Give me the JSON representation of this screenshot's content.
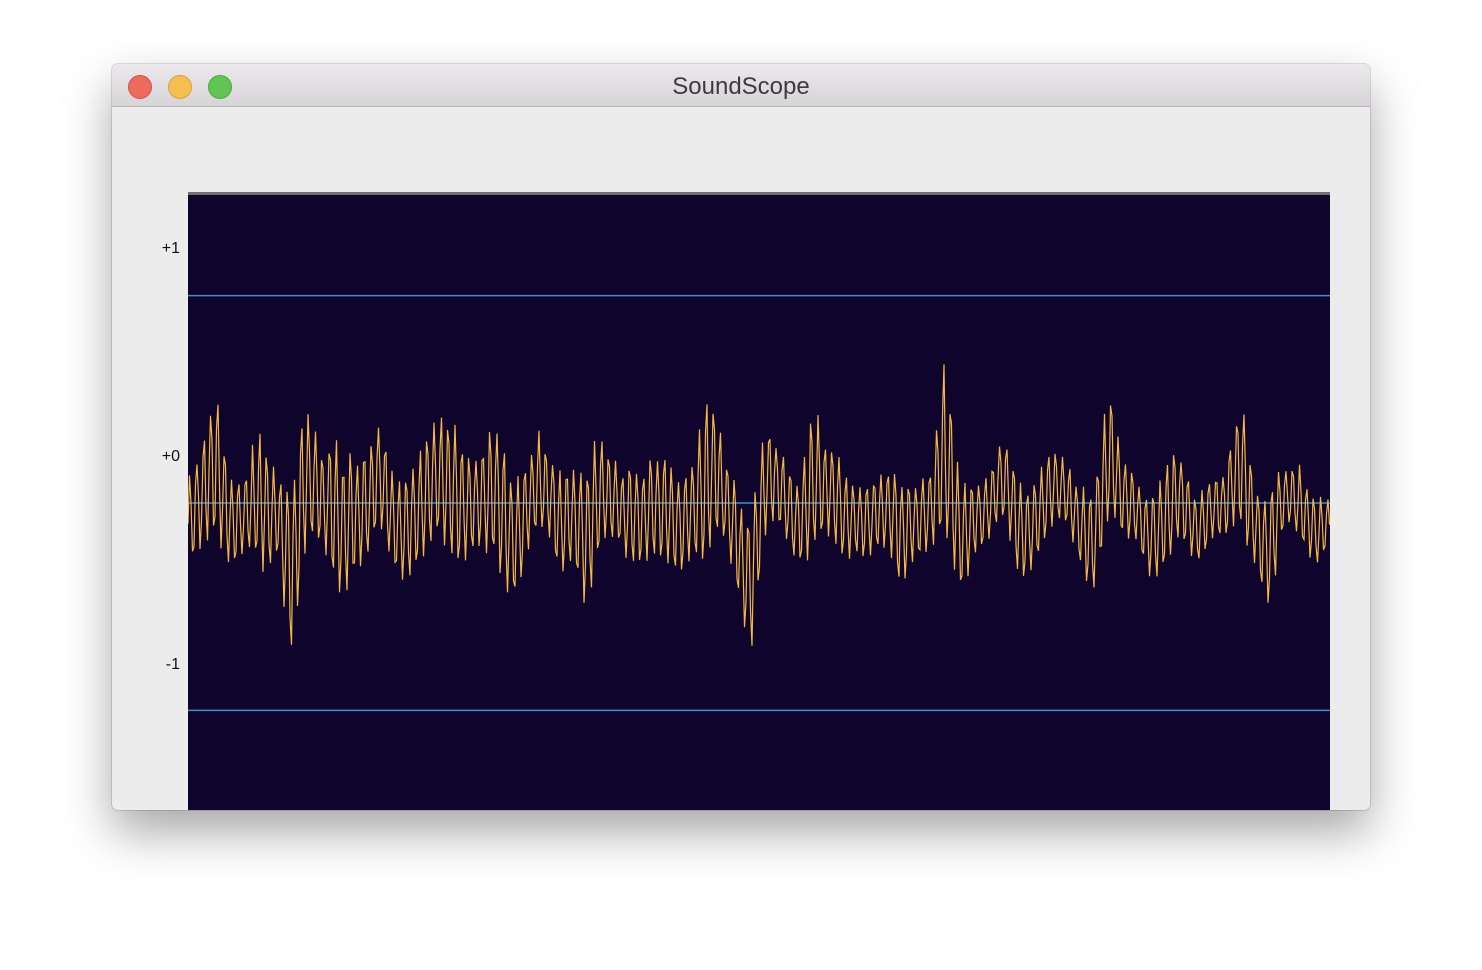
{
  "window": {
    "title": "SoundScope"
  },
  "colors": {
    "scope_background": "#0f042b",
    "waveform": "#f5b942",
    "grid_line": "#3d8ec9",
    "top_border": "#6f6f74"
  },
  "chart_data": {
    "type": "line",
    "title": "",
    "xlabel": "",
    "ylabel": "",
    "ylim": [
      -1.5,
      1.5
    ],
    "yticks": [
      {
        "value": 1,
        "label": "+1"
      },
      {
        "value": 0,
        "label": "+0"
      },
      {
        "value": -1,
        "label": "-1"
      }
    ],
    "grid": true,
    "series": [
      {
        "envelope_upper": [
          0.25,
          0.35,
          0.8,
          0.3,
          0.25,
          0.45,
          0.3,
          0.55,
          0.6,
          0.3,
          0.65,
          0.55,
          0.3,
          0.5,
          0.3,
          0.45,
          0.35,
          0.5,
          0.7,
          0.4,
          0.35,
          0.6,
          0.35,
          0.45,
          0.35,
          0.3,
          0.4,
          0.45,
          0.3,
          0.3,
          0.45,
          0.3,
          0.3,
          0.35,
          0.45,
          0.7,
          0.35,
          0.3,
          0.3,
          0.45,
          0.3,
          0.3,
          0.7,
          0.35,
          0.3,
          0.3,
          0.25,
          0.25,
          0.3,
          0.3,
          0.3,
          0.7,
          0.3,
          0.3,
          0.25,
          0.4,
          0.3,
          0.3,
          0.3,
          0.25,
          0.25,
          0.3,
          0.65,
          0.3,
          0.25,
          0.25,
          0.25,
          0.3,
          0.2,
          0.25,
          0.2,
          0.65,
          0.3,
          0.3,
          0.2,
          0.25,
          0.2,
          0.1
        ],
        "envelope_lower": [
          -0.4,
          -0.45,
          -0.3,
          -0.3,
          -0.3,
          -0.65,
          -0.3,
          -0.75,
          -0.4,
          -0.4,
          -0.5,
          -0.4,
          -0.45,
          -0.3,
          -0.35,
          -0.4,
          -0.45,
          -0.35,
          -0.3,
          -0.3,
          -0.45,
          -0.55,
          -0.45,
          -0.3,
          -0.3,
          -0.45,
          -0.25,
          -0.7,
          -0.35,
          -0.25,
          -0.3,
          -0.4,
          -0.5,
          -0.4,
          -0.25,
          -0.55,
          -0.3,
          -0.45,
          -0.75,
          -0.3,
          -0.25,
          -0.3,
          -0.3,
          -0.35,
          -0.4,
          -0.25,
          -0.3,
          -0.4,
          -0.55,
          -0.25,
          -0.3,
          -0.45,
          -0.55,
          -0.25,
          -0.25,
          -0.25,
          -0.45,
          -0.3,
          -0.25,
          -0.2,
          -0.3,
          -0.45,
          -0.3,
          -0.3,
          -0.2,
          -0.4,
          -0.5,
          -0.3,
          -0.3,
          -0.2,
          -0.3,
          -0.3,
          -0.3,
          -0.6,
          -0.2,
          -0.25,
          -0.3,
          -0.25
        ]
      }
    ]
  }
}
